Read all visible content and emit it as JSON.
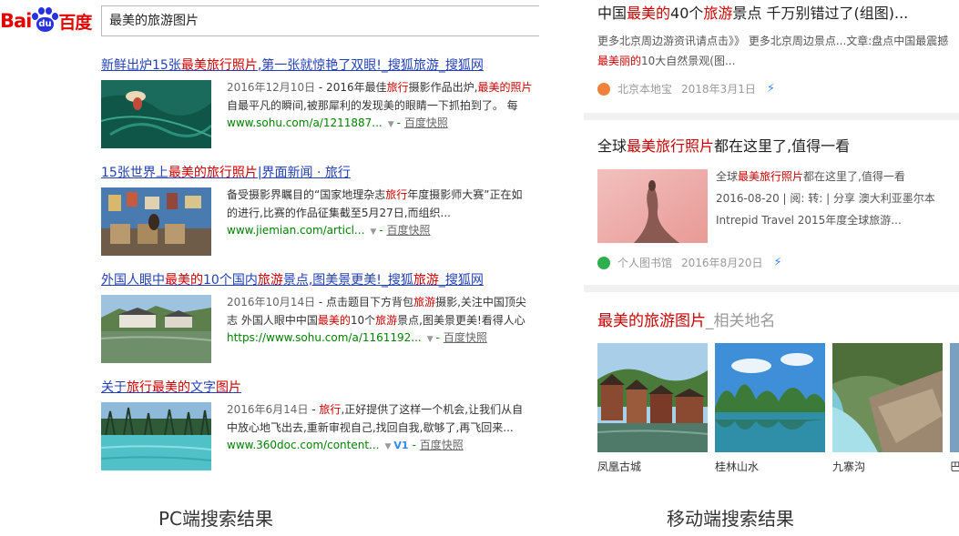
{
  "pc": {
    "logo": {
      "latin": "Bai",
      "paw_text": "du",
      "chinese": "百度"
    },
    "search": {
      "value": "最美的旅游图片"
    },
    "results": [
      {
        "title": [
          "新鲜出炉15张",
          "最美旅行照片",
          ",第一张就惊艳了双眼!_搜狐旅游_搜狐网"
        ],
        "date": "2016年12月10日",
        "snippet": [
          " - 2016年最佳",
          "旅行",
          "摄影作品出炉,",
          "最美的照片",
          "自最平凡的瞬间,被那犀利的发现美的眼睛一下抓拍到了。 每"
        ],
        "url": "www.sohu.com/a/1211887...",
        "snapshot": "百度快照"
      },
      {
        "title": [
          "15张世界上",
          "最美的旅行照片",
          "|界面新闻 · 旅行"
        ],
        "date": "",
        "snippet": [
          "备受摄影界瞩目的“国家地理杂志",
          "旅行",
          "年度摄影师大赛”正在如",
          "",
          "的进行,比赛的作品征集截至5月27日,而组织..."
        ],
        "url": "www.jiemian.com/articl...",
        "snapshot": "百度快照"
      },
      {
        "title": [
          "外国人眼中",
          "最美的",
          "10个国内",
          "旅游",
          "景点,图美景更美!_搜狐",
          "旅游",
          "_搜狐网"
        ],
        "date": "2016年10月14日",
        "snippet": [
          " - 点击题目下方背包",
          "旅游",
          "摄影,关注中国顶尖",
          "",
          "志 外国人眼中中国",
          "最美的",
          "10个",
          "旅游",
          "景点,图美景更美!看得人心"
        ],
        "url": "https://www.sohu.com/a/1161192...",
        "snapshot": "百度快照"
      },
      {
        "title": [
          "关于",
          "旅行最美的",
          "文字",
          "图片"
        ],
        "date": "2016年6月14日",
        "snippet": [
          " - ",
          "旅行",
          ",正好提供了这样一个机会,让我们从自",
          "",
          "中放心地飞出去,重新审视自己,找回自我,歇够了,再飞回来..."
        ],
        "url": "www.360doc.com/content...",
        "badge": "V1",
        "snapshot": "百度快照"
      }
    ]
  },
  "mobile": {
    "card1": {
      "title": [
        "中国",
        "最美的",
        "40个",
        "旅游",
        "景点 千万别错过了(组图)..."
      ],
      "snippet": [
        "更多北京周边游资讯请点击》》 更多北京周边景点...文章:盘点中国最震撼",
        "最美丽的",
        "10大自然景观(图..."
      ],
      "source": "北京本地宝",
      "date": "2018年3月1日"
    },
    "card2": {
      "title": [
        "全球",
        "最美旅行照片",
        "都在这里了,值得一看"
      ],
      "side": [
        "全球",
        "最美旅行照片",
        "都在这里了,值得一看",
        "2016-08-20 | 阅: 转: | 分享 澳大利亚墨尔本Intrepid Travel 2015年度全球旅游..."
      ],
      "source": "个人图书馆",
      "date": "2016年8月20日"
    },
    "card3": {
      "title_red": "最美的旅游图片",
      "title_gray": "_相关地名",
      "places": [
        "凤凰古城",
        "桂林山水",
        "九寨沟",
        "巴"
      ]
    }
  },
  "captions": {
    "pc": "PC端搜索结果",
    "mobile": "移动端搜索结果"
  },
  "colors": {
    "link": "#2440b3",
    "highlight": "#cc0000",
    "url_green": "#008000",
    "baidu_red": "#e10602",
    "baidu_blue": "#2932e1"
  }
}
